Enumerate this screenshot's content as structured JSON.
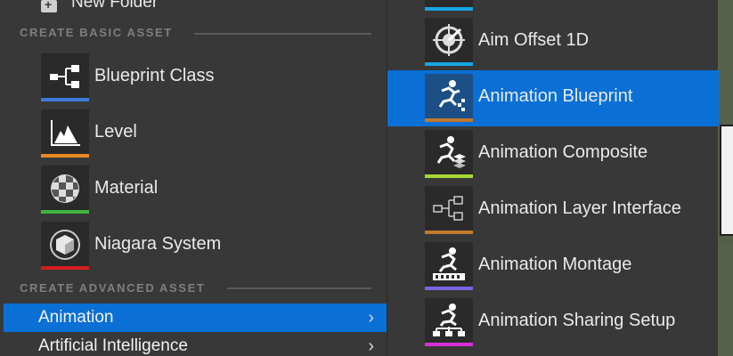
{
  "top_item": {
    "label": "New Folder",
    "icon": "folder-plus-icon"
  },
  "sections": {
    "basic": "CREATE BASIC ASSET",
    "advanced": "CREATE ADVANCED ASSET"
  },
  "basic_assets": [
    {
      "label": "Blueprint Class",
      "icon": "blueprint-class-icon",
      "color": "#3d7bd9"
    },
    {
      "label": "Level",
      "icon": "level-icon",
      "color": "#e88a20"
    },
    {
      "label": "Material",
      "icon": "material-icon",
      "color": "#3fb43f"
    },
    {
      "label": "Niagara System",
      "icon": "niagara-system-icon",
      "color": "#d41e1e"
    }
  ],
  "categories": [
    {
      "label": "Animation",
      "selected": true,
      "chevron": "›"
    },
    {
      "label": "Artificial Intelligence",
      "selected": false,
      "chevron": "›"
    }
  ],
  "submenu": {
    "top_partial_color": "#16a6e0",
    "items": [
      {
        "label": "Aim Offset 1D",
        "icon": "aim-offset-icon",
        "color": "#16a6e0",
        "selected": false
      },
      {
        "label": "Animation Blueprint",
        "icon": "animation-blueprint-icon",
        "color": "#c07a2a",
        "selected": true
      },
      {
        "label": "Animation Composite",
        "icon": "animation-composite-icon",
        "color": "#a8d838",
        "selected": false
      },
      {
        "label": "Animation Layer Interface",
        "icon": "animation-layer-interface-icon",
        "color": "#c07a2a",
        "selected": false
      },
      {
        "label": "Animation Montage",
        "icon": "animation-montage-icon",
        "color": "#7a62e0",
        "selected": false
      },
      {
        "label": "Animation Sharing Setup",
        "icon": "animation-sharing-setup-icon",
        "color": "#d82fd6",
        "selected": false
      }
    ]
  },
  "colors": {
    "panel_bg": "#383838",
    "selection": "#0a70d6"
  }
}
